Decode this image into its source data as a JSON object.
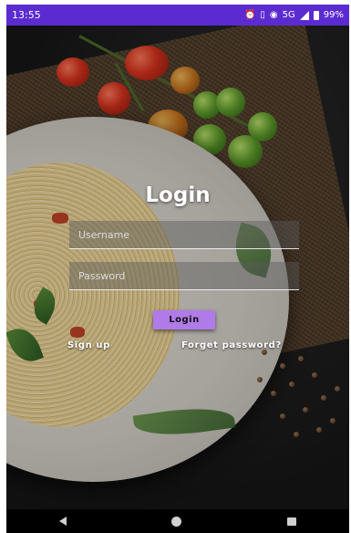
{
  "status_bar": {
    "time": "13:55",
    "network_label": "5G",
    "battery_text": "99%",
    "color": "#5b2bd1"
  },
  "login": {
    "title": "Login",
    "username_placeholder": "Username",
    "password_placeholder": "Password",
    "button_label": "Login",
    "signup_label": "Sign up",
    "forgot_label": "Forget password?",
    "button_color": "#b07be8"
  },
  "navbar": {
    "icons": [
      "back-icon",
      "home-icon",
      "recent-apps-icon"
    ]
  }
}
